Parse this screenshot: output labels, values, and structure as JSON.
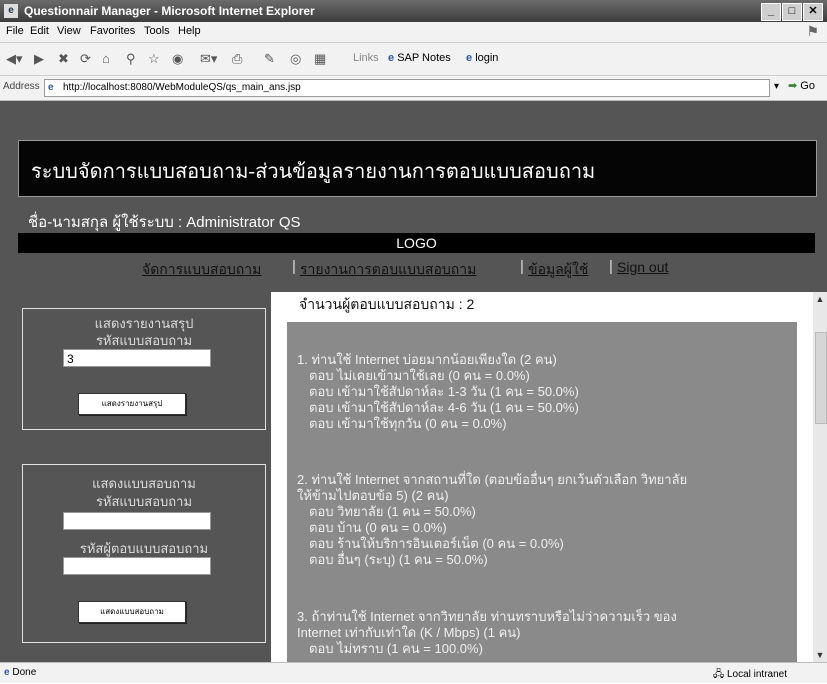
{
  "window": {
    "title": "Questionnair Manager - Microsoft Internet Explorer"
  },
  "menu": [
    "File",
    "Edit",
    "View",
    "Favorites",
    "Tools",
    "Help"
  ],
  "toolbar": {
    "links_label": "Links",
    "sap_notes": "SAP Notes",
    "login": "login"
  },
  "address": {
    "label": "Address",
    "url": "http://localhost:8080/WebModuleQS/qs_main_ans.jsp",
    "go": "Go"
  },
  "page": {
    "system_title": "ระบบจัดการแบบสอบถาม-ส่วนข้อมูลรายงานการตอบแบบสอบถาม",
    "user_line": "ชื่อ-นามสกุล ผู้ใช้ระบบ : Administrator QS",
    "logo": "LOGO",
    "nav": [
      {
        "label": "จัดการแบบสอบถาม"
      },
      {
        "label": "รายงานการตอบแบบสอบถาม"
      },
      {
        "label": "ข้อมูลผู้ใช้"
      },
      {
        "label": "Sign out"
      }
    ],
    "summary_box": {
      "title": "แสดงรายงานสรุป",
      "code_label": "รหัสแบบสอบถาม",
      "code_value": "3",
      "button": "แสดงรายงานสรุป"
    },
    "answer_box": {
      "title": "แสดงแบบสอบถาม",
      "code_label": "รหัสแบบสอบถาม",
      "code_value": "",
      "respondent_label": "รหัสผู้ตอบแบบสอบถาม",
      "respondent_value": "",
      "button": "แสดงแบบสอบถาม"
    },
    "respondent_count": "จำนวนผู้ตอบแบบสอบถาม : 2",
    "questions": [
      {
        "text": "1. ท่านใช้ Internet บ่อยมากน้อยเพียงใด (2 คน)",
        "answers": [
          "ตอบ ไม่เคยเข้ามาใช้เลย (0 คน = 0.0%)",
          "ตอบ เข้ามาใช้สัปดาห์ละ 1-3 วัน (1 คน = 50.0%)",
          "ตอบ เข้ามาใช้สัปดาห์ละ 4-6 วัน (1 คน = 50.0%)",
          "ตอบ เข้ามาใช้ทุกวัน (0 คน = 0.0%)"
        ]
      },
      {
        "text": "2. ท่านใช้ Internet จากสถานที่ใด (ตอบข้ออื่นๆ ยกเว้นตัวเลือก วิทยาลัย",
        "text2": "ให้ข้ามไปตอบข้อ 5) (2 คน)",
        "answers": [
          "ตอบ วิทยาลัย (1 คน = 50.0%)",
          "ตอบ บ้าน (0 คน = 0.0%)",
          "ตอบ ร้านให้บริการอินเตอร์เน็ต (0 คน = 0.0%)",
          "ตอบ อื่นๆ (ระบุ) (1 คน = 50.0%)"
        ]
      },
      {
        "text": "3. ถ้าท่านใช้ Internet จากวิทยาลัย ท่านทราบหรือไม่ว่าความเร็ว ของ",
        "text2": "Internet เท่ากับเท่าใด (K / Mbps) (1 คน)",
        "answers": [
          "ตอบ ไม่ทราบ (1 คน = 100.0%)"
        ]
      }
    ]
  },
  "status": {
    "left": "Done",
    "right": "Local intranet"
  }
}
